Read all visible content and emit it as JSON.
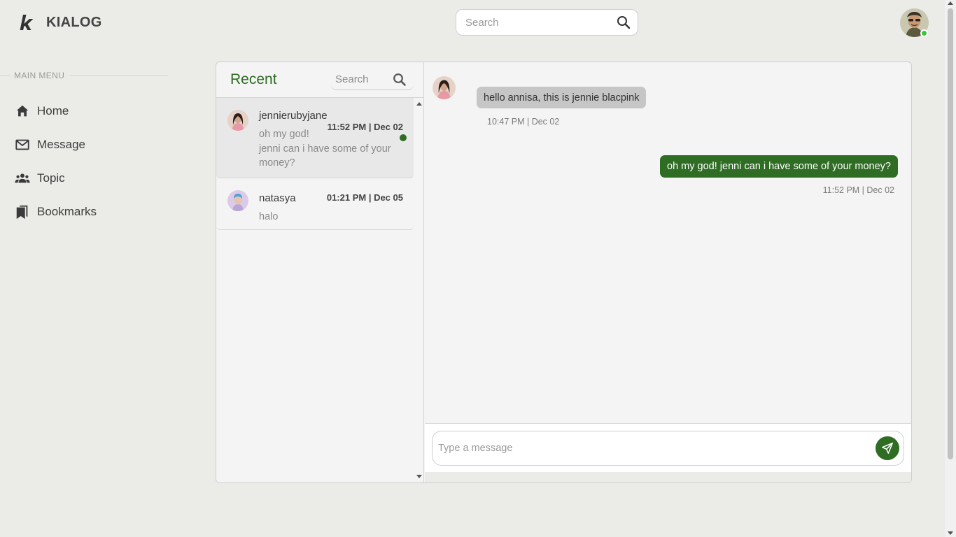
{
  "app": {
    "name": "KIALOG",
    "search_placeholder": "Search"
  },
  "sidebar": {
    "heading": "MAIN MENU",
    "items": [
      {
        "label": "Home",
        "icon": "home-icon"
      },
      {
        "label": "Message",
        "icon": "envelope-icon"
      },
      {
        "label": "Topic",
        "icon": "people-icon"
      },
      {
        "label": "Bookmarks",
        "icon": "bookmark-icon"
      }
    ]
  },
  "recent": {
    "title": "Recent",
    "search_placeholder": "Search",
    "conversations": [
      {
        "name": "jennierubyjane",
        "time": "11:52 PM | Dec 02",
        "preview_line1": "oh my god!",
        "preview_line2": "jenni can i have some of your money?",
        "unread": true,
        "active": true
      },
      {
        "name": "natasya",
        "time": "01:21 PM | Dec 05",
        "preview_line1": "halo",
        "unread": false,
        "active": false
      }
    ]
  },
  "chat": {
    "messages": [
      {
        "direction": "incoming",
        "text": "hello annisa, this is jennie blacpink",
        "time": "10:47 PM | Dec 02"
      },
      {
        "direction": "outgoing",
        "text": "oh my god! jenni can i have some of your money?",
        "time": "11:52 PM | Dec 02"
      }
    ],
    "compose_placeholder": "Type a message"
  },
  "colors": {
    "accent": "#2f6c24",
    "background": "#ebebe8",
    "incoming_bubble": "#c6c6c6",
    "online": "#3bc43b"
  }
}
